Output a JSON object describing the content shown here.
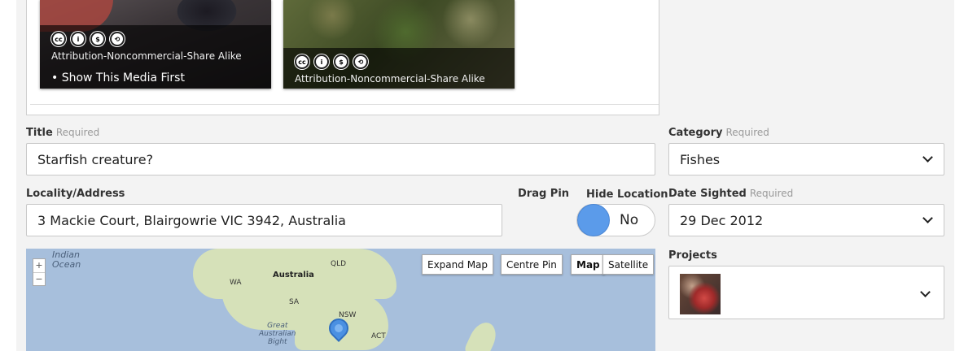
{
  "media": {
    "cards": [
      {
        "license": "Attribution-Noncommercial-Share Alike",
        "action": "• Show This Media First"
      },
      {
        "license": "Attribution-Noncommercial-Share Alike"
      }
    ],
    "cc_icons": [
      "cc",
      "by",
      "nc",
      "sa"
    ]
  },
  "title": {
    "label": "Title",
    "required": "Required",
    "value": "Starfish creature?"
  },
  "category": {
    "label": "Category",
    "required": "Required",
    "value": "Fishes"
  },
  "locality": {
    "label": "Locality/Address",
    "value": "3 Mackie Court, Blairgowrie VIC 3942, Australia"
  },
  "drag_pin": {
    "label": "Drag Pin"
  },
  "hide_location": {
    "label": "Hide Location",
    "value": "No"
  },
  "date_sighted": {
    "label": "Date Sighted",
    "required": "Required",
    "value": "29 Dec 2012"
  },
  "projects": {
    "label": "Projects"
  },
  "map": {
    "buttons": {
      "expand": "Expand Map",
      "centre": "Centre Pin",
      "map": "Map",
      "satellite": "Satellite"
    },
    "zoom": {
      "in": "+",
      "out": "−"
    },
    "labels": {
      "indian_ocean_1": "Indian",
      "indian_ocean_2": "Ocean",
      "australia": "Australia",
      "qld": "QLD",
      "wa": "WA",
      "sa": "SA",
      "nsw": "NSW",
      "act": "ACT",
      "bight_1": "Great",
      "bight_2": "Australian",
      "bight_3": "Bight"
    },
    "colors": {
      "water": "#a7bfdc",
      "land": "#d6e1b9",
      "pin": "#4a90e2"
    }
  },
  "colors": {
    "toggle_knob": "#5b9bea",
    "background": "#f3f3f3"
  }
}
